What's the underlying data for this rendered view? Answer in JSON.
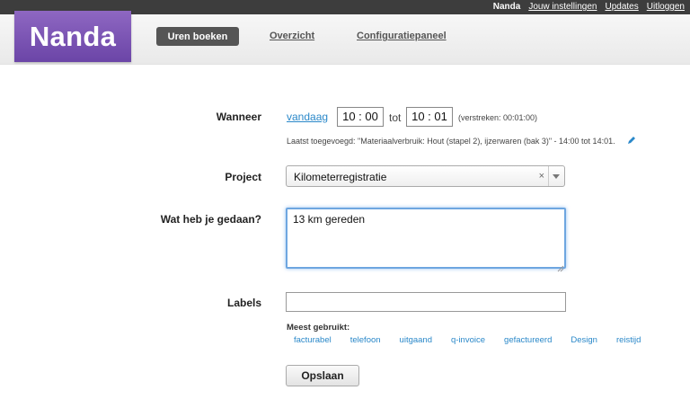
{
  "topbar": {
    "user": "Nanda",
    "links": [
      "Jouw instellingen",
      "Updates",
      "Uitloggen"
    ]
  },
  "header": {
    "logo": "Nanda",
    "nav": [
      "Uren boeken",
      "Overzicht",
      "Configuratiepaneel"
    ],
    "active_nav": "Uren boeken"
  },
  "form": {
    "when": {
      "label": "Wanneer",
      "date_link": "vandaag",
      "start_time": "10 : 00",
      "to_text": "tot",
      "end_time": "10 : 01",
      "elapsed": "(verstreken: 00:01:00)",
      "last_added": "Laatst toegevoegd: \"Materiaalverbruik: Hout (stapel 2), ijzerwaren (bak 3)\" - 14:00 tot 14:01."
    },
    "project": {
      "label": "Project",
      "value": "Kilometerregistratie",
      "clear": "×"
    },
    "what": {
      "label": "Wat heb je gedaan?",
      "value": "13 km gereden"
    },
    "labels": {
      "label": "Labels",
      "value": "",
      "most_used_title": "Meest gebruikt:",
      "most_used": [
        "facturabel",
        "telefoon",
        "uitgaand",
        "q-invoice",
        "gefactureerd",
        "Design",
        "reistijd"
      ]
    },
    "save_label": "Opslaan"
  },
  "colors": {
    "brand": "#7c55b6",
    "link": "#2a88c9",
    "focus": "#6ea6e0"
  }
}
